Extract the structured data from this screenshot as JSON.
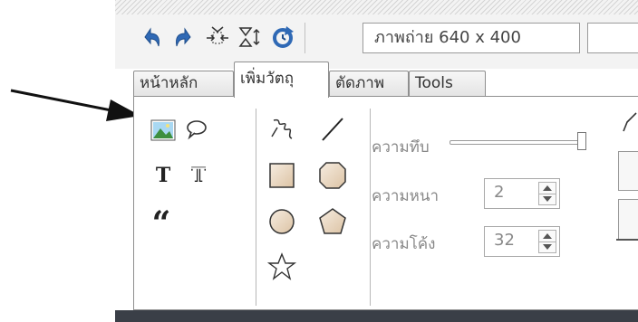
{
  "toolbar": {
    "size_text": "ภาพถ่าย 640 x 400",
    "icons": [
      "undo-icon",
      "redo-icon",
      "fit-width-icon",
      "fit-height-icon",
      "rotate-icon"
    ]
  },
  "tabs": [
    {
      "label": "หน้าหลัก",
      "active": false
    },
    {
      "label": "เพิ่มวัตถุ",
      "active": true
    },
    {
      "label": "ตัดภาพ",
      "active": false
    },
    {
      "label": "Tools",
      "active": false
    }
  ],
  "panel": {
    "opacity_label": "ความทึบ",
    "opacity_value": 1.0,
    "thickness_label": "ความหนา",
    "thickness_value": "2",
    "curve_label": "ความโค้ง",
    "curve_value": "32"
  },
  "colors": {
    "toolbar_bg": "#f3f3f3",
    "bottom_bar": "#3a3f47",
    "icon_blue": "#2f69b5",
    "shape_fill": "#ead9c4"
  }
}
